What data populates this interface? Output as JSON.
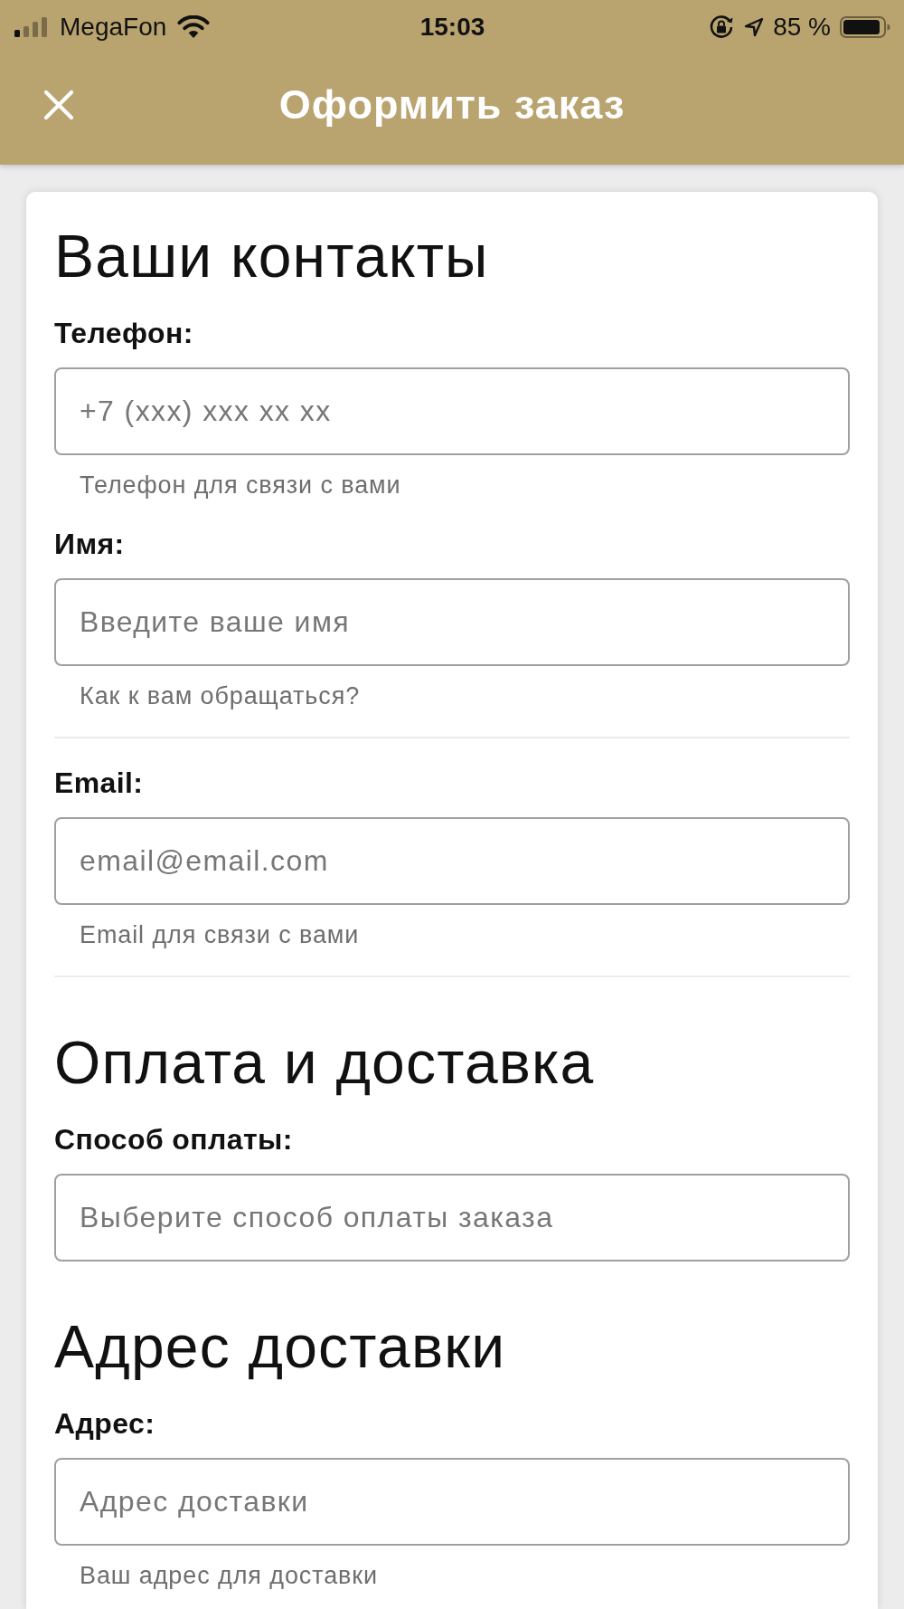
{
  "status_bar": {
    "carrier": "MegaFon",
    "time": "15:03",
    "battery": "85 %"
  },
  "header": {
    "title": "Оформить заказ"
  },
  "sections": [
    {
      "title": "Ваши контакты",
      "fields": [
        {
          "label": "Телефон:",
          "placeholder": "+7 (xxx) xxx xx xx",
          "hint": "Телефон для связи с вами",
          "divider": false
        },
        {
          "label": "Имя:",
          "placeholder": "Введите ваше имя",
          "hint": "Как к вам обращаться?",
          "divider": true
        },
        {
          "label": "Email:",
          "placeholder": "email@email.com",
          "hint": "Email для связи с вами",
          "divider": true
        }
      ]
    },
    {
      "title": "Оплата и доставка",
      "fields": [
        {
          "label": "Способ оплаты:",
          "placeholder": "Выберите способ оплаты заказа",
          "divider": false
        }
      ]
    },
    {
      "title": "Адрес доставки",
      "fields": [
        {
          "label": "Адрес:",
          "placeholder": "Адрес доставки",
          "hint": "Ваш адрес для доставки",
          "divider": false
        }
      ]
    }
  ]
}
